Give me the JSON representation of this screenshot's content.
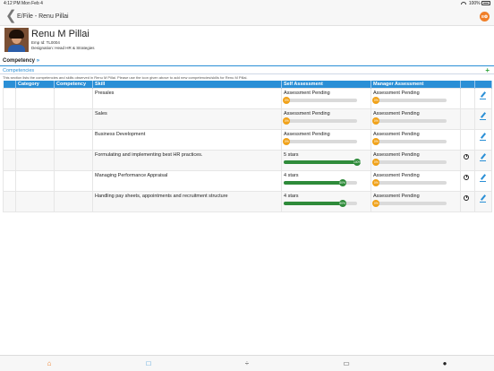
{
  "statusbar": {
    "time": "4:12 PM  Mon Feb 4",
    "battery": "100%"
  },
  "navbar": {
    "back_glyph": "❮",
    "title": "E/File - Renu Pillai",
    "user_initials": "E❂"
  },
  "profile": {
    "name": "Renu M Pillai",
    "emp_id": "Emp Id: TL0004",
    "designation": "Designation: Head HR & Strategies"
  },
  "section": {
    "label": "Competency",
    "chevron": "»"
  },
  "competencies": {
    "label": "Competencies",
    "add_glyph": "+",
    "description": "This section lists the competencies and skills observed in Renu M Pillai. Please use the icon given above to add new competencies/skills for Renu M Pillai."
  },
  "table": {
    "headers": [
      "",
      "Category",
      "Competency",
      "Skill",
      "Self Assessment",
      "Manager Assessment",
      "",
      ""
    ],
    "rows": [
      {
        "skill": "Presales",
        "self": {
          "label": "Assessment Pending",
          "knob": "0%",
          "fill": 0,
          "color": "#f0a21a"
        },
        "manager": {
          "label": "Assessment Pending",
          "knob": "0%",
          "fill": 0,
          "color": "#f0a21a"
        },
        "history": false
      },
      {
        "skill": "Sales",
        "self": {
          "label": "Assessment Pending",
          "knob": "0%",
          "fill": 0,
          "color": "#f0a21a"
        },
        "manager": {
          "label": "Assessment Pending",
          "knob": "0%",
          "fill": 0,
          "color": "#f0a21a"
        },
        "history": false
      },
      {
        "skill": "Business Development",
        "self": {
          "label": "Assessment Pending",
          "knob": "0%",
          "fill": 0,
          "color": "#f0a21a"
        },
        "manager": {
          "label": "Assessment Pending",
          "knob": "0%",
          "fill": 0,
          "color": "#f0a21a"
        },
        "history": false
      },
      {
        "skill": "Formulating and implementing best HR practices.",
        "self": {
          "label": "5 stars",
          "knob": "100%",
          "fill": 1.0,
          "color": "#2e8b3a"
        },
        "manager": {
          "label": "Assessment Pending",
          "knob": "0%",
          "fill": 0,
          "color": "#f0a21a"
        },
        "history": true
      },
      {
        "skill": "Managing Performance Appraisal",
        "self": {
          "label": "4 stars",
          "knob": "80%",
          "fill": 0.8,
          "color": "#2e8b3a"
        },
        "manager": {
          "label": "Assessment Pending",
          "knob": "0%",
          "fill": 0,
          "color": "#f0a21a"
        },
        "history": true
      },
      {
        "skill": "Handling pay sheets, appointments and recruitment structure",
        "self": {
          "label": "4 stars",
          "knob": "80%",
          "fill": 0.8,
          "color": "#2e8b3a"
        },
        "manager": {
          "label": "Assessment Pending",
          "knob": "0%",
          "fill": 0,
          "color": "#f0a21a"
        },
        "history": true
      }
    ]
  },
  "tabbar": {
    "items": [
      {
        "name": "home-icon",
        "glyph": "⌂",
        "color": "#f07f28"
      },
      {
        "name": "square-icon",
        "glyph": "□",
        "color": "#2a8fd6"
      },
      {
        "name": "divide-icon",
        "glyph": "÷",
        "color": "#555555"
      },
      {
        "name": "chat-icon",
        "glyph": "▭",
        "color": "#555555"
      },
      {
        "name": "person-icon",
        "glyph": "●",
        "color": "#222222"
      }
    ]
  }
}
